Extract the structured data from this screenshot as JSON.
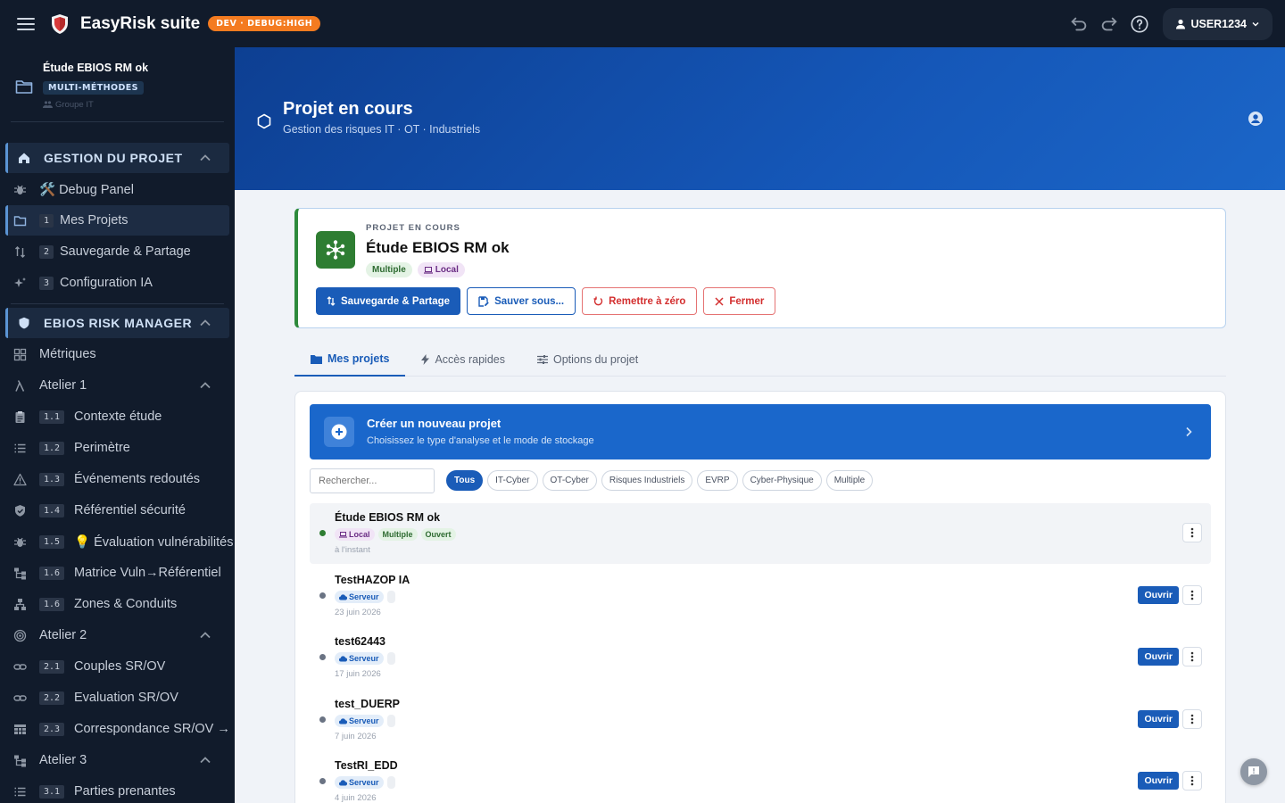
{
  "topbar": {
    "app_title": "EasyRisk suite",
    "env_badge": "DEV · DEBUG:HIGH",
    "user_label": "USER1234"
  },
  "sidebar": {
    "project_name": "Étude EBIOS RM ok",
    "project_tag": "MULTI-MÉTHODES",
    "project_group": "Groupe IT",
    "sections": [
      {
        "label": "GESTION DU PROJET",
        "icon": "home-icon"
      },
      {
        "label": "EBIOS RISK MANAGER",
        "icon": "shield-icon"
      }
    ],
    "items": [
      {
        "label": "🛠️ Debug Panel",
        "num": "",
        "icon": "bug-icon"
      },
      {
        "label": "Mes Projets",
        "num": "1",
        "icon": "folder-icon"
      },
      {
        "label": "Sauvegarde & Partage",
        "num": "2",
        "icon": "sync-icon"
      },
      {
        "label": "Configuration IA",
        "num": "3",
        "icon": "sparkle-icon"
      },
      {
        "label": "Métriques",
        "num": "",
        "icon": "grid-icon"
      },
      {
        "label": "Atelier 1",
        "num": "",
        "icon": "lambda-icon"
      },
      {
        "label": "Contexte étude",
        "num": "1.1",
        "icon": "clipboard-icon"
      },
      {
        "label": "Perimètre",
        "num": "1.2",
        "icon": "list-icon"
      },
      {
        "label": "Événements redoutés",
        "num": "1.3",
        "icon": "warning-icon"
      },
      {
        "label": "Référentiel sécurité",
        "num": "1.4",
        "icon": "shield-check-icon"
      },
      {
        "label": "💡 Évaluation vulnérabilités",
        "num": "1.5",
        "icon": "bug-icon"
      },
      {
        "label": "Matrice Vuln→Référentiel",
        "num": "1.6",
        "icon": "tree-icon"
      },
      {
        "label": "Zones & Conduits",
        "num": "1.6",
        "icon": "sitemap-icon"
      },
      {
        "label": "Atelier 2",
        "num": "",
        "icon": "target-icon"
      },
      {
        "label": "Couples SR/OV",
        "num": "2.1",
        "icon": "link-icon"
      },
      {
        "label": "Evaluation SR/OV",
        "num": "2.2",
        "icon": "link-icon"
      },
      {
        "label": "Correspondance SR/OV → EF",
        "num": "2.3",
        "icon": "table-icon"
      },
      {
        "label": "Atelier 3",
        "num": "",
        "icon": "tree-icon"
      },
      {
        "label": "Parties prenantes",
        "num": "3.1",
        "icon": "list-icon"
      }
    ]
  },
  "hero": {
    "title": "Projet en cours",
    "subtitle": "Gestion des risques IT · OT · Industriels"
  },
  "current_project": {
    "kicker": "PROJET EN COURS",
    "title": "Étude EBIOS RM ok",
    "chip_method": "Multiple",
    "chip_storage": "Local",
    "btn_save_share": "Sauvegarde & Partage",
    "btn_save_as": "Sauver sous...",
    "btn_reset": "Remettre à zéro",
    "btn_close": "Fermer"
  },
  "tabs": [
    "Mes projets",
    "Accès rapides",
    "Options du projet"
  ],
  "create": {
    "title": "Créer un nouveau projet",
    "subtitle": "Choisissez le type d'analyse et le mode de stockage"
  },
  "search": {
    "placeholder": "Rechercher..."
  },
  "filters": [
    "Tous",
    "IT-Cyber",
    "OT-Cyber",
    "Risques Industriels",
    "EVRP",
    "Cyber-Physique",
    "Multiple"
  ],
  "projects": [
    {
      "name": "Étude EBIOS RM ok",
      "chips": [
        "Local",
        "Multiple",
        "Ouvert"
      ],
      "date": "à l'instant"
    },
    {
      "name": "TestHAZOP IA",
      "chips": [
        "Serveur"
      ],
      "date": "23 juin 2026",
      "action": "Ouvrir"
    },
    {
      "name": "test62443",
      "chips": [
        "Serveur"
      ],
      "date": "17 juin 2026",
      "action": "Ouvrir"
    },
    {
      "name": "test_DUERP",
      "chips": [
        "Serveur"
      ],
      "date": "7 juin 2026",
      "action": "Ouvrir"
    },
    {
      "name": "TestRI_EDD",
      "chips": [
        "Serveur"
      ],
      "date": "4 juin 2026",
      "action": "Ouvrir"
    }
  ]
}
